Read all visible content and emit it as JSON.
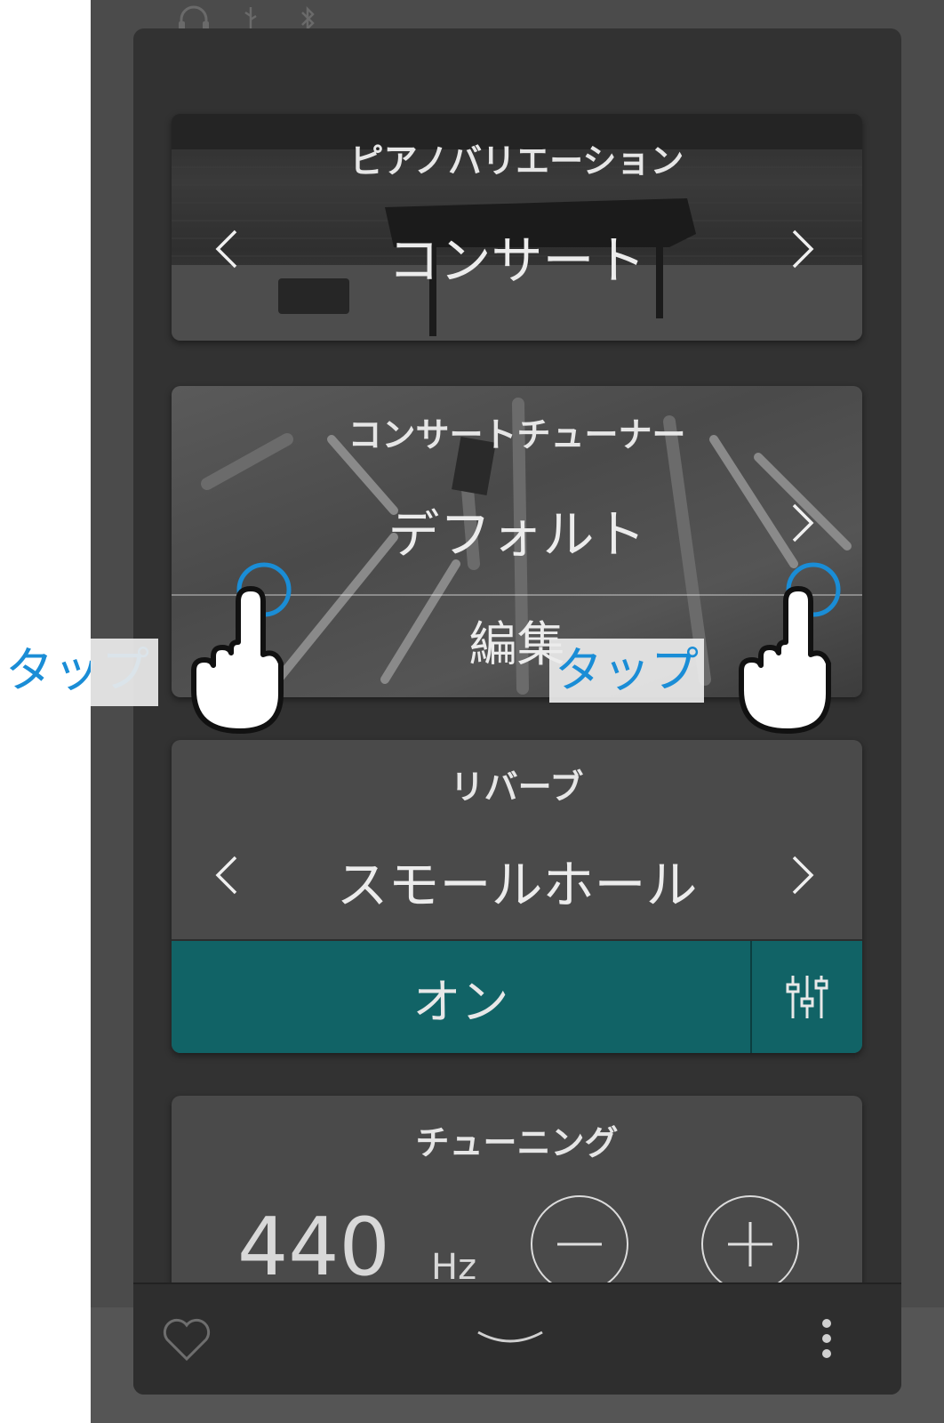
{
  "status_icons": [
    "headphones-icon",
    "usb-icon",
    "bluetooth-icon"
  ],
  "piano_variation": {
    "title": "ピアノバリエーション",
    "value": "コンサート"
  },
  "concert_tuner": {
    "title": "コンサートチューナー",
    "value": "デフォルト",
    "edit_label": "編集"
  },
  "reverb": {
    "title": "リバーブ",
    "value": "スモールホール",
    "toggle_label": "オン"
  },
  "tuning": {
    "title": "チューニング",
    "value": "440",
    "unit": "Hz"
  },
  "bottom_bar": {
    "icons": [
      "heart-icon",
      "chevron-down-icon",
      "more-vertical-icon"
    ]
  },
  "annotations": {
    "tap_left": "タップ",
    "tap_right": "タップ"
  },
  "colors": {
    "accent": "#116366",
    "tap_blue": "#1a8dd6",
    "panel": "#323232"
  }
}
